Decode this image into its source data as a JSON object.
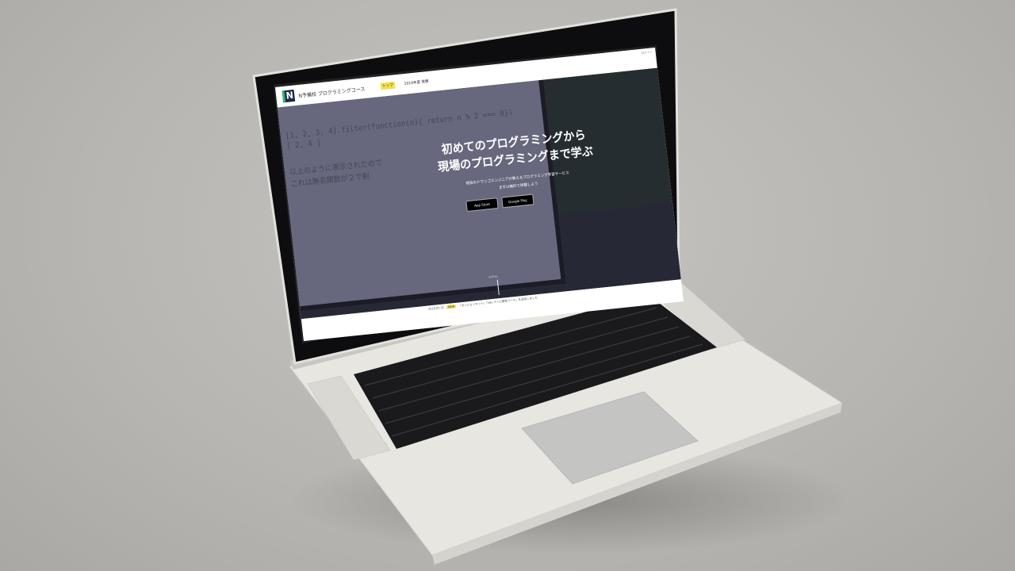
{
  "site": {
    "brand": "N予備校 プログラミングコース",
    "logo_letter": "N",
    "login": "ログイン",
    "nav": [
      {
        "label": "トップ",
        "active": true
      },
      {
        "label": "2019年度 実績",
        "active": false
      }
    ]
  },
  "hero": {
    "code_lines": [
      "[1, 2, 3, 4].filter(function(n){ return n % 2 === 0})",
      "[ 2, 4 ]",
      "以上のように表示されたので",
      "これは無名関数が２で割"
    ],
    "headline_1": "初めてのプログラミングから",
    "headline_2": "現場のプログラミングまで学ぶ",
    "sub_1": "現役のドワンゴエンジニアが教えるプログラミング学習サービス",
    "sub_2": "まずは無料で体験しよう",
    "app_store": "App Store",
    "google_play": "Google Play",
    "scroll": "SCROLL"
  },
  "news": {
    "date": "2020.05.22",
    "tag": "NEW",
    "text": "「ダンジョンキット」「n8s ゲーム開発コース」を追加しました"
  },
  "colors": {
    "accent_yellow": "#f4e04d",
    "logo_navy": "#1b2a4a",
    "logo_green": "#37b26c"
  }
}
